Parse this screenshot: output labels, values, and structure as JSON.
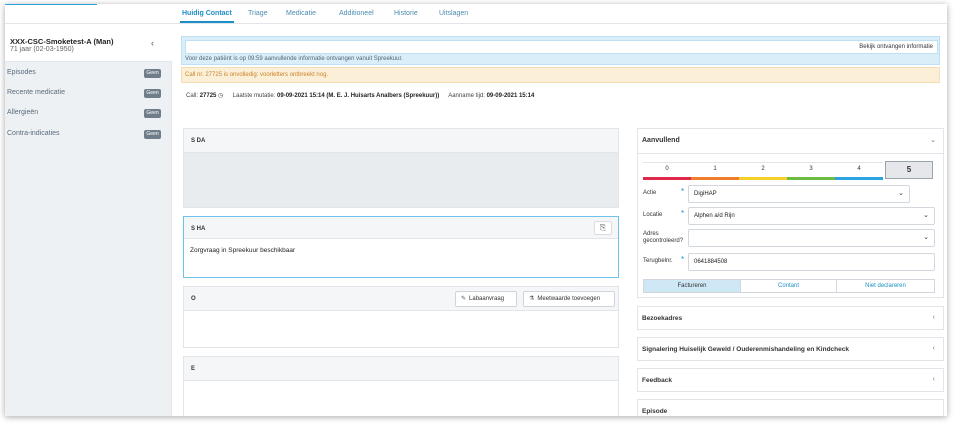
{
  "tabs": [
    {
      "label": "Huidig Contact",
      "active": true
    },
    {
      "label": "Triage"
    },
    {
      "label": "Medicatie"
    },
    {
      "label": "Additioneel"
    },
    {
      "label": "Historie"
    },
    {
      "label": "Uitslagen"
    }
  ],
  "patient": {
    "name": "XXX-CSC-Smoketest-A (Man)",
    "age": "71 jaar (02-03-1950)"
  },
  "sidebar": {
    "items": [
      {
        "label": "Episodes",
        "badge": "Geen"
      },
      {
        "label": "Recente medicatie",
        "badge": "Geen"
      },
      {
        "label": "Allergieën",
        "badge": "Geen"
      },
      {
        "label": "Contra-indicaties",
        "badge": "Geen"
      }
    ]
  },
  "info": {
    "see_link": "Bekijk ontvangen informatie",
    "message": "Voor deze patiënt is op 09:59 aanvullende informatie ontvangen vanuit Spreekuur."
  },
  "warning": {
    "message": "Call nr. 27725 is onvolledig: voorletters ontbreekt nog."
  },
  "call": {
    "label": "Call:",
    "number": "27725",
    "mutation_label": "Laatste mutatie:",
    "mutation_value": "09-09-2021 15:14 (M. E. J. Huisarts Analbers (Spreekuur))",
    "accept_label": "Aanname tijd:",
    "accept_value": "09-09-2021 15:14"
  },
  "cards": {
    "sda": {
      "title": "S DA"
    },
    "sha": {
      "title": "S HA",
      "text": "Zorgvraag in Spreekuur beschikbaar"
    },
    "o": {
      "title": "O",
      "btn_lab": "Labaanvraag",
      "btn_meet": "Meetwaarde toevoegen"
    },
    "e": {
      "title": "E"
    }
  },
  "aanvullend": {
    "title": "Aanvullend",
    "scale": [
      {
        "label": "0",
        "color": "#e0284a"
      },
      {
        "label": "1",
        "color": "#f07c2e"
      },
      {
        "label": "2",
        "color": "#f5cf2a"
      },
      {
        "label": "3",
        "color": "#6dbb43"
      },
      {
        "label": "4",
        "color": "#2aa3e0"
      }
    ],
    "selected": "5",
    "actie_label": "Actie",
    "actie_value": "DigiHAP",
    "locatie_label": "Locatie",
    "locatie_value": "Alphen a/d Rijn",
    "adres_label_1": "Adres",
    "adres_label_2": "gecontroleerd?",
    "adres_value": "",
    "terug_label": "Terugbelnr.",
    "terug_value": "0641884508",
    "billing": [
      "Factureren",
      "Contant",
      "Niet declareren"
    ]
  },
  "accordions": [
    "Bezoekadres",
    "Signalering Huiselijk Geweld / Ouderenmishandeling en Kindcheck",
    "Feedback",
    "Episode"
  ]
}
